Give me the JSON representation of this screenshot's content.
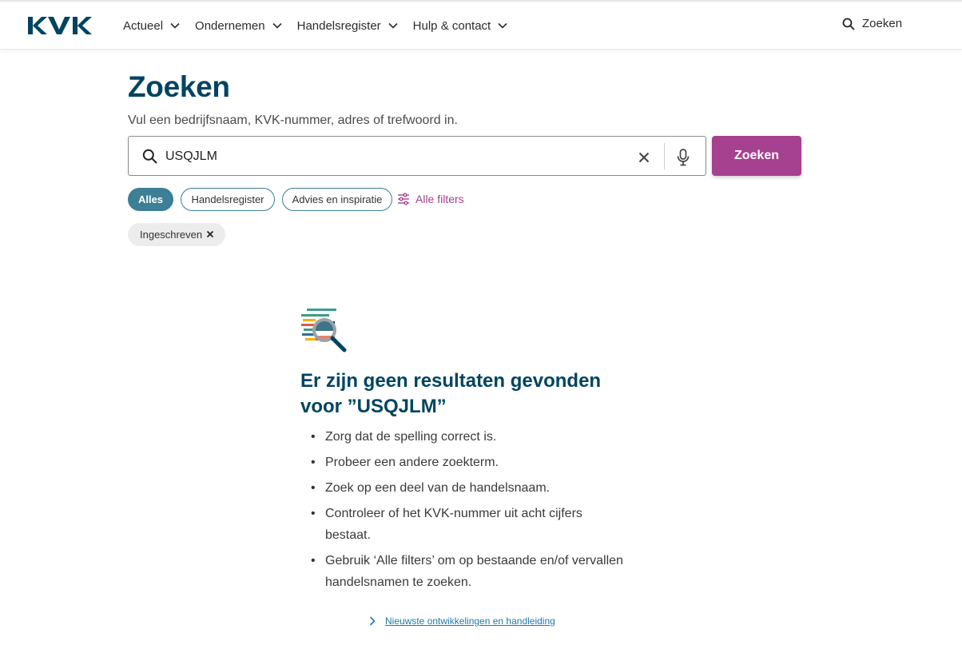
{
  "brand": {
    "logo_text": "KVK",
    "primary_color": "#004461",
    "accent_color": "#a5418f",
    "chip_color": "#3c7f96"
  },
  "header": {
    "nav": [
      {
        "label": "Actueel"
      },
      {
        "label": "Ondernemen"
      },
      {
        "label": "Handelsregister"
      },
      {
        "label": "Hulp & contact"
      }
    ],
    "search_label": "Zoeken"
  },
  "search": {
    "title": "Zoeken",
    "intro": "Vul een bedrijfsnaam, KVK-nummer, adres of trefwoord in.",
    "query": "USQJLM",
    "button_label": "Zoeken",
    "icons": {
      "search": "search-icon",
      "clear": "close-icon",
      "voice": "microphone-icon"
    }
  },
  "filters": {
    "chips": [
      {
        "label": "Alles",
        "active": true
      },
      {
        "label": "Handelsregister",
        "active": false
      },
      {
        "label": "Advies en inspiratie",
        "active": false
      }
    ],
    "all_filters_label": "Alle filters",
    "active_tags": [
      {
        "label": "Ingeschreven"
      }
    ]
  },
  "no_results": {
    "illustration": "document-search-icon",
    "title": "Er zijn geen resultaten gevonden voor ”USQJLM”",
    "tips": [
      "Zorg dat de spelling correct is.",
      "Probeer een andere zoekterm.",
      "Zoek op een deel van de handelsnaam.",
      "Controleer of het KVK-nummer uit acht cijfers bestaat.",
      "Gebruik ‘Alle filters’ om op bestaande en/of vervallen handelsnamen te zoeken."
    ],
    "link_label": "Nieuwste ontwikkelingen en handleiding"
  }
}
